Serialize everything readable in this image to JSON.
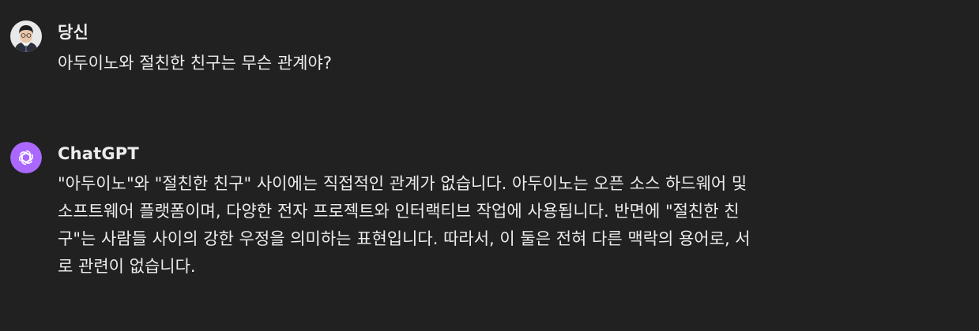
{
  "conversation": {
    "user": {
      "author": "당신",
      "avatar": "user-photo-icon",
      "message": "아두이노와 절친한 친구는 무슨 관계야?"
    },
    "assistant": {
      "author": "ChatGPT",
      "avatar": "openai-logo-icon",
      "avatar_color": "#ab68ff",
      "lines": [
        "\"아두이노\"와 \"절친한 친구\" 사이에는 직접적인 관계가 없습니다. 아두이노는 오픈 소스 하드웨어 및",
        "소프트웨어 플랫폼이며, 다양한 전자 프로젝트와 인터랙티브 작업에 사용됩니다. 반면에 \"절친한 친",
        "구\"는 사람들 사이의 강한 우정을 의미하는 표현입니다. 따라서, 이 둘은 전혀 다른 맥락의 용어로, 서",
        "로 관련이 없습니다."
      ]
    }
  },
  "colors": {
    "background": "#212121",
    "text": "#ececec",
    "assistant_avatar": "#ab68ff"
  }
}
